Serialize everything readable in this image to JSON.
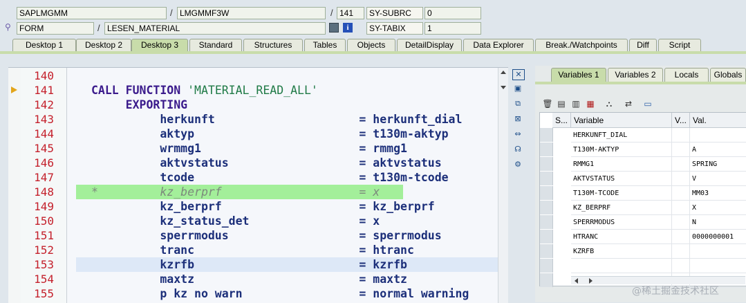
{
  "header": {
    "program": "SAPLMGMM",
    "include": "LMGMMF3W",
    "line": "141",
    "sysubrc_label": "SY-SUBRC",
    "sysubrc_value": "0",
    "event_type": "FORM",
    "event_name": "LESEN_MATERIAL",
    "sytabix_label": "SY-TABIX",
    "sytabix_value": "1",
    "sep1": "/",
    "sep2": "/",
    "sep3": "/"
  },
  "tabs": [
    "Desktop 1",
    "Desktop 2",
    "Desktop 3",
    "Standard",
    "Structures",
    "Tables",
    "Objects",
    "DetailDisplay",
    "Data Explorer",
    "Break./Watchpoints",
    "Diff",
    "Script"
  ],
  "active_tab": "Desktop 3",
  "editor": {
    "lines": [
      {
        "num": "140",
        "code": ""
      },
      {
        "num": "141",
        "code": "CALL FUNCTION 'MATERIAL_READ_ALL'"
      },
      {
        "num": "142",
        "code": "     EXPORTING"
      },
      {
        "num": "143",
        "code": "          herkunft                     = herkunft_dial"
      },
      {
        "num": "144",
        "code": "          aktyp                        = t130m-aktyp"
      },
      {
        "num": "145",
        "code": "          wrmmg1                       = rmmg1"
      },
      {
        "num": "146",
        "code": "          aktvstatus                   = aktvstatus"
      },
      {
        "num": "147",
        "code": "          tcode                        = t130m-tcode"
      },
      {
        "num": "148",
        "code": "*         kz_berprf                    = x"
      },
      {
        "num": "149",
        "code": "          kz_berprf                    = kz_berprf"
      },
      {
        "num": "150",
        "code": "          kz_status_det                = x"
      },
      {
        "num": "151",
        "code": "          sperrmodus                   = sperrmodus"
      },
      {
        "num": "152",
        "code": "          tranc                        = htranc"
      },
      {
        "num": "153",
        "code": "          kzrfb                        = kzrfb"
      },
      {
        "num": "154",
        "code": "          maxtz                        = maxtz"
      },
      {
        "num": "155",
        "code": "          p kz no warn                 = normal warning"
      }
    ],
    "current_line": "141",
    "commented_line": "148",
    "highlighted_line": "153"
  },
  "variables_panel": {
    "tabs": [
      "Variables 1",
      "Variables 2",
      "Locals",
      "Globals"
    ],
    "active_tab": "Variables 1",
    "columns": [
      "S...",
      "Variable",
      "V...",
      "Val."
    ],
    "rows": [
      {
        "variable": "HERKUNFT_DIAL",
        "value": ""
      },
      {
        "variable": "T130M-AKTYP",
        "value": "A"
      },
      {
        "variable": "RMMG1",
        "value": "SPRING"
      },
      {
        "variable": "AKTVSTATUS",
        "value": "V"
      },
      {
        "variable": "T130M-TCODE",
        "value": "MM03"
      },
      {
        "variable": "KZ_BERPRF",
        "value": "X"
      },
      {
        "variable": "SPERRMODUS",
        "value": "N"
      },
      {
        "variable": "HTRANC",
        "value": "0000000001"
      },
      {
        "variable": "KZRFB",
        "value": ""
      }
    ]
  },
  "watermark": "@稀土掘金技术社区"
}
